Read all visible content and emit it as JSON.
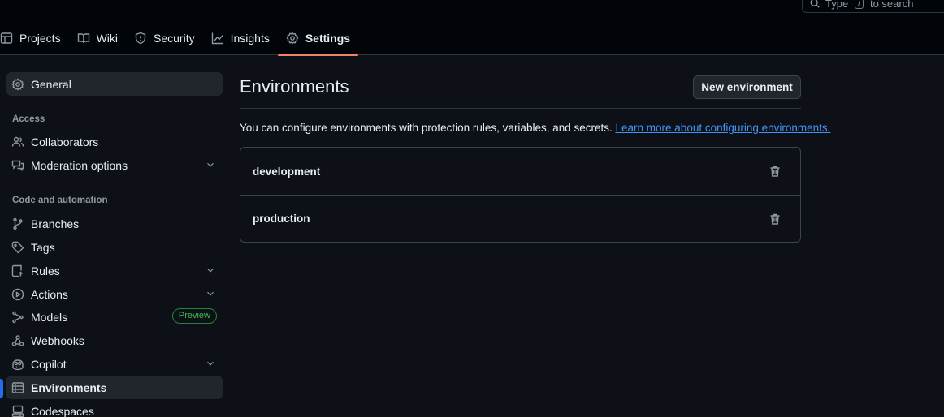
{
  "header": {
    "search": {
      "prefix": "Type",
      "key": "/",
      "suffix": "to search"
    },
    "tabs": [
      {
        "label": "Projects",
        "icon": "table-icon"
      },
      {
        "label": "Wiki",
        "icon": "book-icon"
      },
      {
        "label": "Security",
        "icon": "shield-icon"
      },
      {
        "label": "Insights",
        "icon": "graph-icon"
      },
      {
        "label": "Settings",
        "icon": "gear-icon",
        "active": true
      }
    ]
  },
  "sidebar": {
    "general": "General",
    "groups": [
      {
        "heading": "Access",
        "items": [
          "Collaborators",
          "Moderation options"
        ]
      },
      {
        "heading": "Code and automation",
        "items": [
          "Branches",
          "Tags",
          "Rules",
          "Actions",
          "Models",
          "Webhooks",
          "Copilot",
          "Environments",
          "Codespaces"
        ]
      }
    ],
    "models_badge": "Preview",
    "current": "Environments"
  },
  "main": {
    "title": "Environments",
    "new_button": "New environment",
    "description": "You can configure environments with protection rules, variables, and secrets.",
    "learn_more": "Learn more about configuring environments.",
    "environments": [
      "development",
      "production"
    ]
  },
  "colors": {
    "background": "#0d1117",
    "header_bg": "#010409",
    "active_tab_underline": "#f78166",
    "link": "#4493f8",
    "current_indicator": "#1f6feb",
    "badge": "#3fb950"
  }
}
